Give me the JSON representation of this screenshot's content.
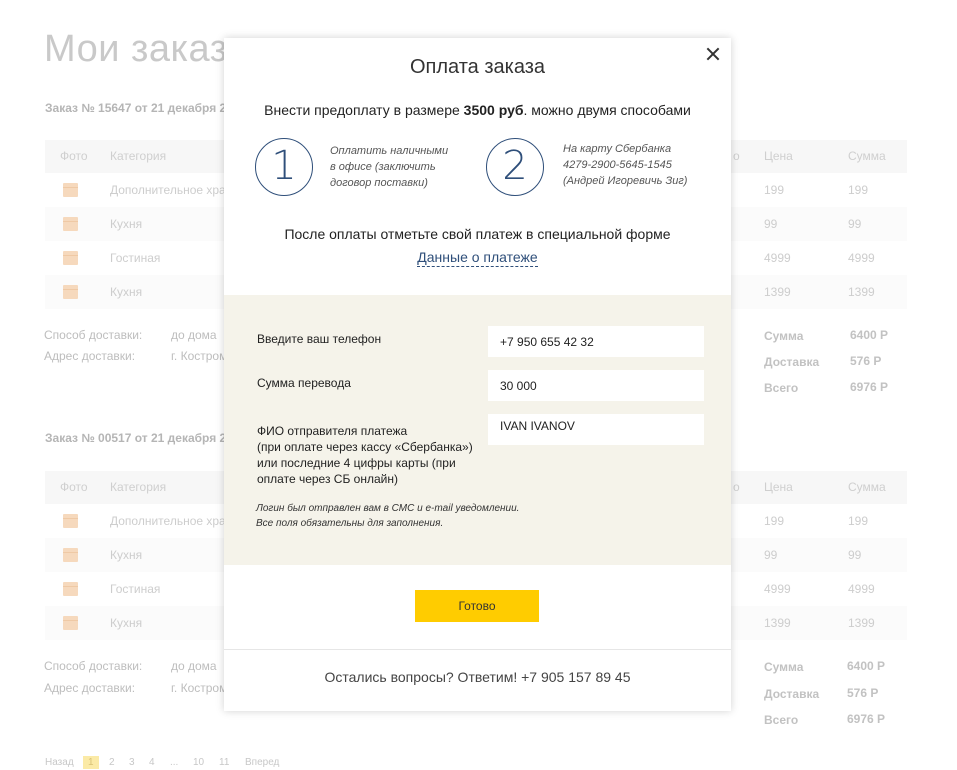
{
  "background": {
    "page_title": "Мои заказы",
    "columns": [
      "Фото",
      "Категория",
      "Цена",
      "Сумма"
    ],
    "column_fragment": "о",
    "orders": [
      {
        "header": "Заказ № 15647 от 21 декабря 2",
        "rows": [
          {
            "category": "Дополнительное хра",
            "price": "199",
            "sum": "199"
          },
          {
            "category": "Кухня",
            "price": "99",
            "sum": "99"
          },
          {
            "category": "Гостиная",
            "price": "4999",
            "sum": "4999"
          },
          {
            "category": "Кухня",
            "price": "1399",
            "sum": "1399"
          }
        ],
        "delivery_method_label": "Способ доставки:",
        "delivery_method_value": "до дома",
        "delivery_address_label": "Адрес доставки:",
        "delivery_address_value": "г. Костром",
        "totals": [
          {
            "label": "Сумма",
            "value": "6400 Р"
          },
          {
            "label": "Доставка",
            "value": "576 Р"
          },
          {
            "label": "Всего",
            "value": "6976 Р"
          }
        ]
      },
      {
        "header": "Заказ № 00517 от 21 декабря 2",
        "rows": [
          {
            "category": "Дополнительное хра",
            "price": "199",
            "sum": "199"
          },
          {
            "category": "Кухня",
            "price": "99",
            "sum": "99"
          },
          {
            "category": "Гостиная",
            "price": "4999",
            "sum": "4999"
          },
          {
            "category": "Кухня",
            "price": "1399",
            "sum": "1399"
          }
        ],
        "delivery_method_label": "Способ доставки:",
        "delivery_method_value": "до дома",
        "delivery_address_label": "Адрес доставки:",
        "delivery_address_value": "г. Костром",
        "totals": [
          {
            "label": "Сумма",
            "value": "6400 Р"
          },
          {
            "label": "Доставка",
            "value": "576 Р"
          },
          {
            "label": "Всего",
            "value": "6976 Р"
          }
        ]
      }
    ],
    "pagination": {
      "prev": "Назад",
      "pages": [
        "1",
        "2",
        "3",
        "4",
        "...",
        "10",
        "11"
      ],
      "current": "1",
      "next": "Вперед"
    }
  },
  "modal": {
    "title": "Оплата заказа",
    "subtitle_pre": "Внести предоплату в размере ",
    "subtitle_amount": "3500 руб",
    "subtitle_post": ". можно двумя способами",
    "ways": [
      {
        "number": "1",
        "lines": [
          "Оплатить наличными",
          "в офисе (заключить",
          "договор поставки)"
        ]
      },
      {
        "number": "2",
        "lines": [
          "На карту Сбербанка",
          "4279-2900-5645-1545",
          "(Андрей Игоревичь Зиг)"
        ]
      }
    ],
    "after_payment_text": "После оплаты отметьте свой платеж в специальной форме",
    "payment_link": "Данные о платеже",
    "form": {
      "phone_label": "Введите ваш телефон",
      "phone_value": "+7 950 655 42 32",
      "amount_label": "Сумма перевода",
      "amount_value": "30 000",
      "sender_label_lines": [
        "ФИО отправителя платежа",
        "(при оплате через кассу «Сбербанка»)",
        "или последние 4 цифры карты (при",
        "оплате через СБ онлайн)"
      ],
      "sender_value": "IVAN IVANOV",
      "note_lines": [
        "Логин был отправлен вам в СМС и e-mail уведомлении.",
        "Все поля обязательны для заполнения."
      ]
    },
    "submit_label": "Готово",
    "footer_text": "Остались вопросы? Ответим! +7 905 157 89 45",
    "colors": {
      "accent_button": "#ffcc00",
      "link": "#2f4f7a",
      "form_bg": "#f5f3ea"
    }
  }
}
